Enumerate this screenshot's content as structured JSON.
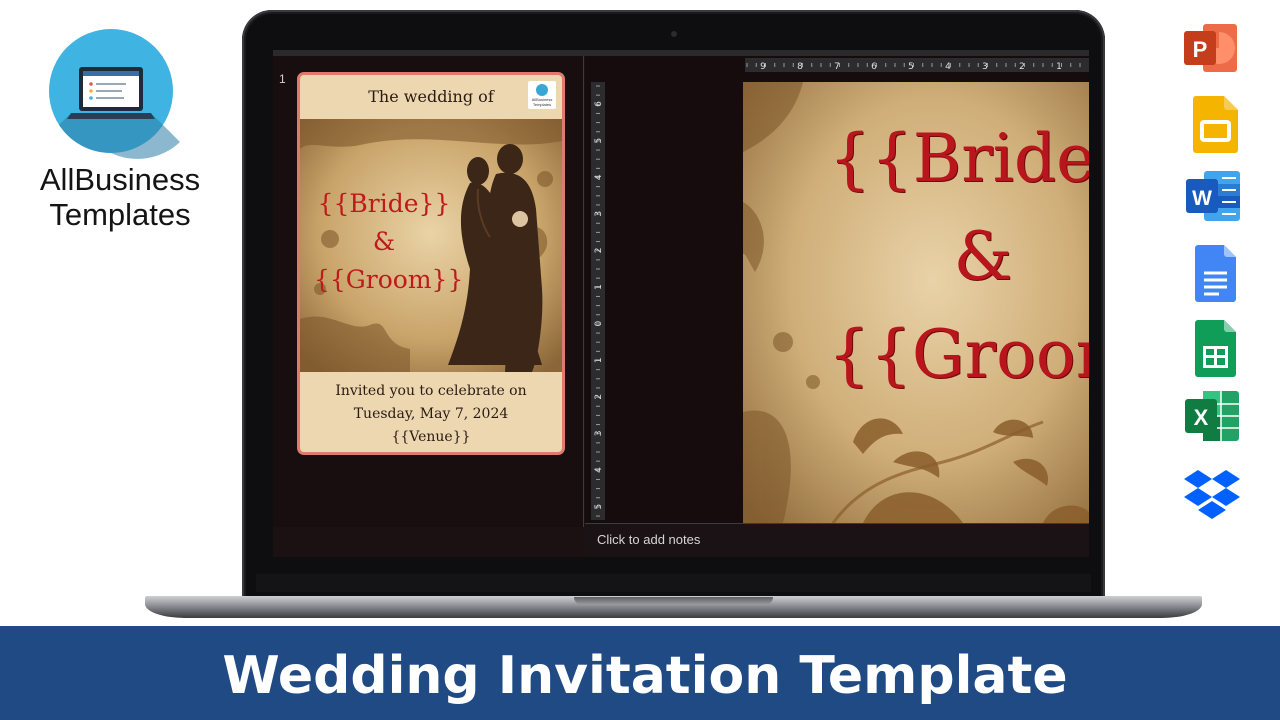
{
  "brand": {
    "name_line1": "AllBusiness",
    "name_line2": "Templates",
    "logo_icon": "laptop-icon",
    "colors": {
      "circle": "#3fb3e2",
      "shadow": "#2c6b8c"
    }
  },
  "presentation": {
    "slide_number": "1",
    "thumbnail": {
      "title": "The wedding of",
      "badge_text": "AllBusiness Templates",
      "bride": "{{Bride}}",
      "ampersand": "&",
      "groom": "{{Groom}}",
      "invite_line1": "Invited you to celebrate on",
      "invite_line2": "Tuesday, May 7, 2024",
      "invite_line3": "{{Venue}}"
    },
    "canvas": {
      "bride": "{{Bride}",
      "ampersand": "&",
      "groom": "{{Groom"
    },
    "notes_placeholder": "Click to add notes",
    "ruler_h_ticks": [
      "9",
      "8",
      "7",
      "6",
      "5",
      "4",
      "3",
      "2",
      "1"
    ],
    "ruler_v_ticks": [
      "6",
      "5",
      "4",
      "3",
      "2",
      "1",
      "0",
      "1",
      "2",
      "3",
      "4",
      "5"
    ]
  },
  "apps": [
    {
      "name": "PowerPoint",
      "icon": "powerpoint-icon",
      "color": "#d24726",
      "letter": "P"
    },
    {
      "name": "Google Slides",
      "icon": "google-slides-icon",
      "color": "#f4b400",
      "letter": ""
    },
    {
      "name": "Word",
      "icon": "word-icon",
      "color": "#2b579a",
      "letter": "W"
    },
    {
      "name": "Google Docs",
      "icon": "google-docs-icon",
      "color": "#4285f4",
      "letter": ""
    },
    {
      "name": "Google Sheets",
      "icon": "google-sheets-icon",
      "color": "#0f9d58",
      "letter": ""
    },
    {
      "name": "Excel",
      "icon": "excel-icon",
      "color": "#217346",
      "letter": "X"
    },
    {
      "name": "Dropbox",
      "icon": "dropbox-icon",
      "color": "#0061ff",
      "letter": ""
    }
  ],
  "footer": {
    "title": "Wedding Invitation Template",
    "color": "#1f4a84"
  }
}
